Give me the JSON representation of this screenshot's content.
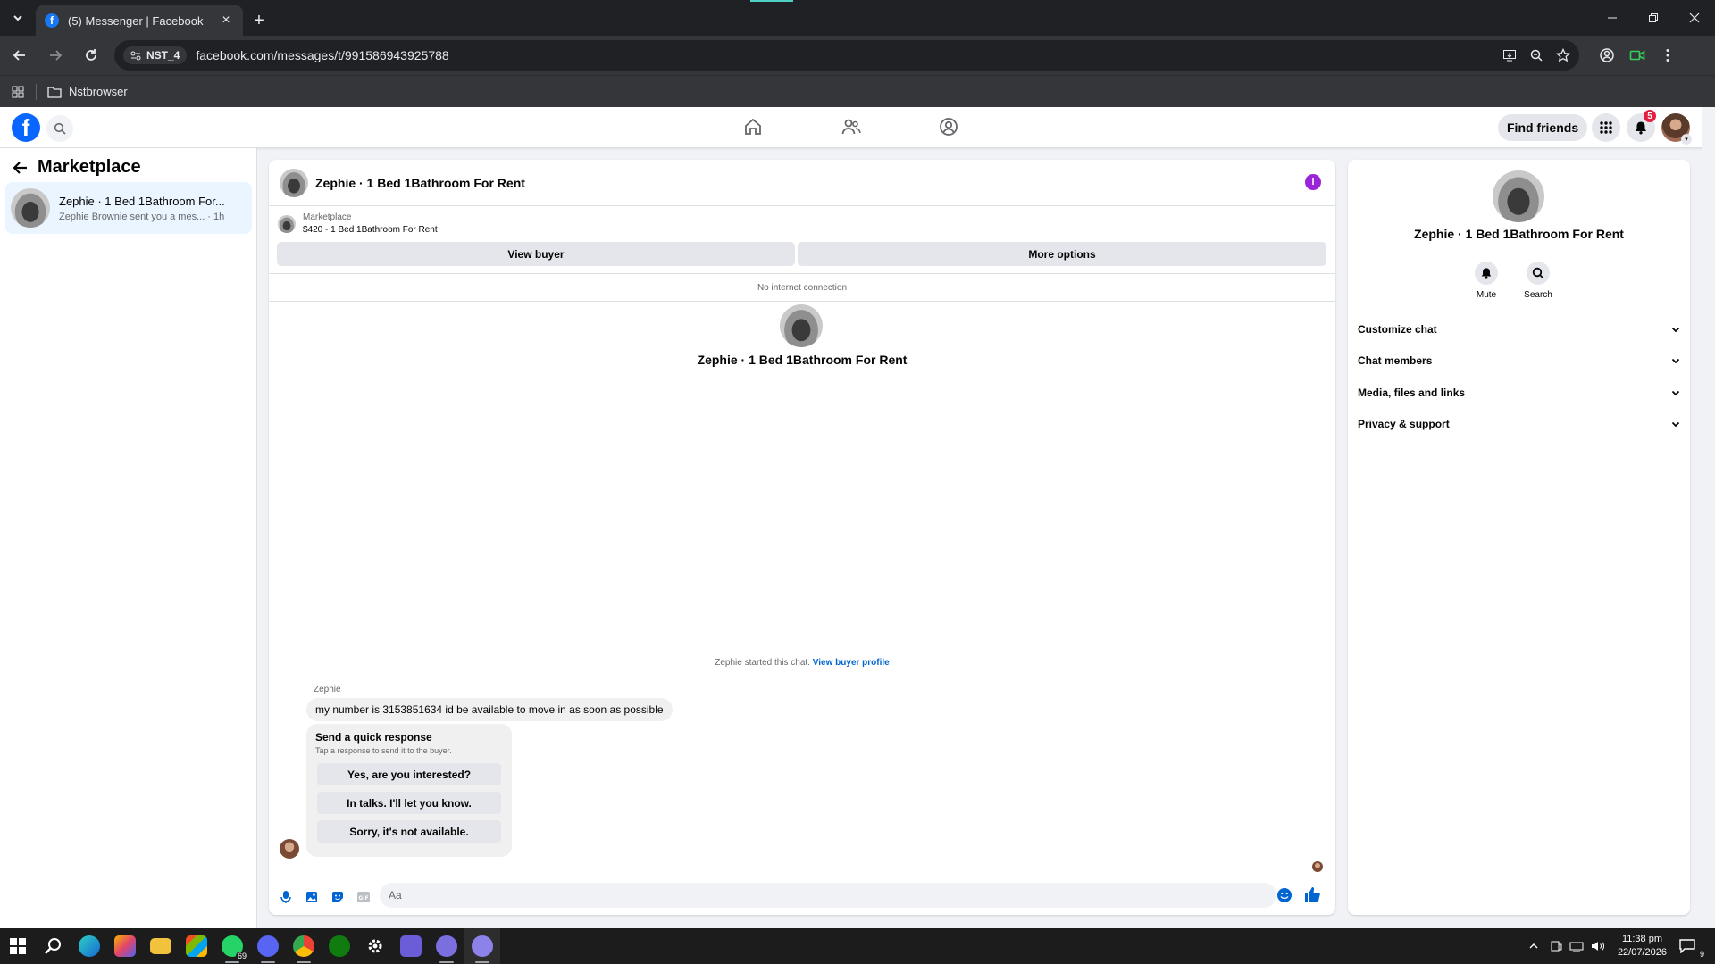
{
  "browser": {
    "tab_title": "(5) Messenger | Facebook",
    "tab_close": "×",
    "new_tab": "+",
    "profile_chip": "NST_4",
    "url": "facebook.com/messages/t/991586943925788",
    "bookmark_folder": "Nstbrowser"
  },
  "fb_header": {
    "find_friends": "Find friends",
    "notification_count": "5"
  },
  "left_panel": {
    "heading": "Marketplace",
    "threads": [
      {
        "name": "Zephie · 1 Bed 1Bathroom For...",
        "preview": "Zephie Brownie sent you a mes... · 1h"
      }
    ]
  },
  "chat": {
    "title": "Zephie · 1 Bed 1Bathroom For Rent",
    "info_icon": "i",
    "marketplace_label": "Marketplace",
    "listing": "$420 - 1 Bed 1Bathroom For Rent",
    "view_buyer": "View buyer",
    "more_options": "More options",
    "connection_status": "No internet connection",
    "profile_name": "Zephie · 1 Bed 1Bathroom For Rent",
    "started_text": "Zephie started this chat.",
    "view_buyer_profile": "View buyer profile",
    "sender_name": "Zephie",
    "message": "my number is 3153851634 id be available to move in as soon as possible",
    "quick_response": {
      "title": "Send a quick response",
      "subtitle": "Tap a response to send it to the buyer.",
      "options": [
        "Yes, are you interested?",
        "In talks. I'll let you know.",
        "Sorry, it's not available."
      ]
    },
    "composer_placeholder": "Aa"
  },
  "right_panel": {
    "name": "Zephie · 1 Bed 1Bathroom For Rent",
    "actions": [
      "Mute",
      "Search"
    ],
    "sections": [
      "Customize chat",
      "Chat members",
      "Media, files and links",
      "Privacy & support"
    ]
  },
  "taskbar": {
    "whatsapp_badge": "69",
    "time": "11:38 pm",
    "date": "22/07/2026",
    "notif_count": "9"
  },
  "colors": {
    "fb_blue": "#0866ff",
    "messenger_blue": "#0064d1",
    "info_purple": "#9b24d9",
    "notification_red": "#e41e3f"
  }
}
